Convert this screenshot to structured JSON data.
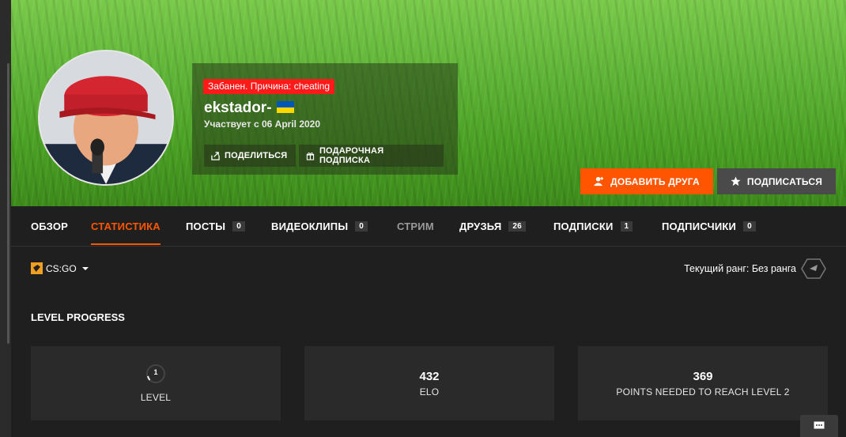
{
  "profile": {
    "ban_badge": "Забанен. Причина: cheating",
    "username": "ekstador-",
    "member_since": "Участвует с 06 April 2020",
    "share_label": "ПОДЕЛИТЬСЯ",
    "gift_label": "ПОДАРОЧНАЯ ПОДПИСКА",
    "flag_colors": [
      "#0057b7",
      "#ffd700"
    ]
  },
  "actions": {
    "add_friend": "ДОБАВИТЬ ДРУГА",
    "follow": "ПОДПИСАТЬСЯ"
  },
  "nav": {
    "items": [
      {
        "label": "ОБЗОР"
      },
      {
        "label": "СТАТИСТИКА",
        "active": true
      },
      {
        "label": "ПОСТЫ",
        "count": "0"
      },
      {
        "label": "ВИДЕОКЛИПЫ",
        "count": "0"
      },
      {
        "label": "СТРИМ"
      },
      {
        "label": "ДРУЗЬЯ",
        "count": "26"
      },
      {
        "label": "ПОДПИСКИ",
        "count": "1"
      },
      {
        "label": "ПОДПИСЧИКИ",
        "count": "0"
      }
    ]
  },
  "stats": {
    "game": "CS:GO",
    "rank_text": "Текущий ранг: Без ранга",
    "section_title": "LEVEL PROGRESS",
    "level": {
      "value": "1",
      "label": "LEVEL"
    },
    "elo": {
      "value": "432",
      "label": "ELO"
    },
    "points": {
      "value": "369",
      "label": "POINTS NEEDED TO REACH LEVEL 2"
    }
  },
  "colors": {
    "accent": "#ff5500",
    "ban_red": "#ff1a1a",
    "background": "#1f1f1f",
    "card": "#2a2a2a"
  }
}
